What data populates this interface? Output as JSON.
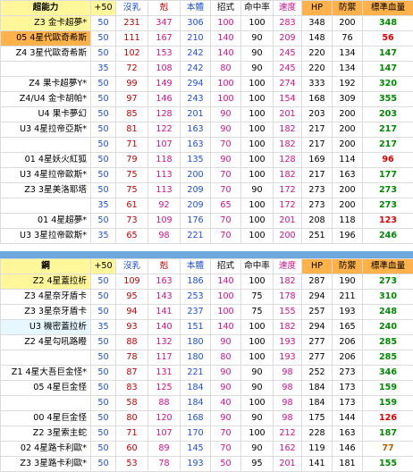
{
  "colors": {
    "header_yellow": "#fff79a",
    "header_orange": "#ffb14a",
    "blue_text": "#1f4fd6",
    "dark_red_text": "#c00000",
    "pink_text": "#d0118a",
    "green_text": "#008a00",
    "red_text": "#e00000",
    "separator": "#6fa8dc"
  },
  "top": {
    "header": [
      "超能力",
      "+50",
      "沒乳",
      "剋",
      "本體",
      "招式",
      "命中率",
      "速度",
      "HP",
      "防禦",
      "標準血量"
    ],
    "rows": [
      {
        "name": "Z3 金卡超夢*",
        "p50": "50",
        "a": "231",
        "b": "347",
        "c": "306",
        "d": "100",
        "e": "100",
        "f": "283",
        "hp": "348",
        "def": "200",
        "std": "348",
        "nameHl": "yellow",
        "stdColor": "green"
      },
      {
        "name": "05 4星代歐奇希斯",
        "p50": "50",
        "a": "111",
        "b": "167",
        "c": "210",
        "d": "140",
        "e": "90",
        "f": "209",
        "hp": "148",
        "def": "76",
        "std": "56",
        "nameHl": "orange",
        "stdColor": "red"
      },
      {
        "name": "Z4 3星代歐奇希斯",
        "p50": "50",
        "a": "102",
        "b": "153",
        "c": "242",
        "d": "140",
        "e": "90",
        "f": "245",
        "hp": "220",
        "def": "134",
        "std": "147",
        "nameHl": "",
        "stdColor": "green"
      },
      {
        "name": "",
        "p50": "35",
        "a": "72",
        "b": "108",
        "c": "242",
        "d": "80",
        "e": "90",
        "f": "245",
        "hp": "220",
        "def": "134",
        "std": "147",
        "nameHl": "",
        "stdColor": "green"
      },
      {
        "name": "Z4 果卡超夢Y*",
        "p50": "50",
        "a": "99",
        "b": "149",
        "c": "294",
        "d": "100",
        "e": "100",
        "f": "274",
        "hp": "333",
        "def": "192",
        "std": "320",
        "nameHl": "",
        "stdColor": "green"
      },
      {
        "name": "Z4/U4 金卡胡帕*",
        "p50": "50",
        "a": "97",
        "b": "146",
        "c": "243",
        "d": "100",
        "e": "100",
        "f": "154",
        "hp": "168",
        "def": "309",
        "std": "355",
        "nameHl": "",
        "stdColor": "green"
      },
      {
        "name": "U4 果卡夢幻",
        "p50": "50",
        "a": "85",
        "b": "128",
        "c": "201",
        "d": "90",
        "e": "100",
        "f": "201",
        "hp": "203",
        "def": "200",
        "std": "203",
        "nameHl": "",
        "stdColor": "green"
      },
      {
        "name": "U3 4星拉帝亞斯*",
        "p50": "50",
        "a": "81",
        "b": "122",
        "c": "163",
        "d": "90",
        "e": "100",
        "f": "182",
        "hp": "217",
        "def": "200",
        "std": "217",
        "nameHl": "",
        "stdColor": "green"
      },
      {
        "name": "",
        "p50": "50",
        "a": "71",
        "b": "107",
        "c": "163",
        "d": "70",
        "e": "100",
        "f": "182",
        "hp": "217",
        "def": "200",
        "std": "217",
        "nameHl": "",
        "stdColor": "green"
      },
      {
        "name": "01 4星妖火紅狐",
        "p50": "50",
        "a": "79",
        "b": "118",
        "c": "135",
        "d": "90",
        "e": "100",
        "f": "128",
        "hp": "169",
        "def": "114",
        "std": "96",
        "nameHl": "",
        "stdColor": "red"
      },
      {
        "name": "U3 4星拉帝歐斯*",
        "p50": "50",
        "a": "75",
        "b": "113",
        "c": "200",
        "d": "70",
        "e": "100",
        "f": "182",
        "hp": "217",
        "def": "163",
        "std": "177",
        "nameHl": "",
        "stdColor": "green"
      },
      {
        "name": "Z3 3星美洛耶塔",
        "p50": "50",
        "a": "75",
        "b": "113",
        "c": "209",
        "d": "70",
        "e": "90",
        "f": "172",
        "hp": "273",
        "def": "200",
        "std": "273",
        "nameHl": "",
        "stdColor": "green"
      },
      {
        "name": "",
        "p50": "35",
        "a": "61",
        "b": "92",
        "c": "209",
        "d": "65",
        "e": "100",
        "f": "172",
        "hp": "273",
        "def": "200",
        "std": "273",
        "nameHl": "",
        "stdColor": "green"
      },
      {
        "name": "01 4星超夢*",
        "p50": "50",
        "a": "73",
        "b": "109",
        "c": "176",
        "d": "70",
        "e": "100",
        "f": "201",
        "hp": "208",
        "def": "118",
        "std": "123",
        "nameHl": "",
        "stdColor": "red"
      },
      {
        "name": "U3 3星拉帝歐斯*",
        "p50": "35",
        "a": "65",
        "b": "98",
        "c": "221",
        "d": "70",
        "e": "100",
        "f": "200",
        "hp": "251",
        "def": "196",
        "std": "246",
        "nameHl": "",
        "stdColor": "green"
      }
    ]
  },
  "bottom": {
    "header": [
      "鋼",
      "+50",
      "沒乳",
      "剋",
      "本體",
      "招式",
      "命中率",
      "速度",
      "HP",
      "防禦",
      "標準血量"
    ],
    "rows": [
      {
        "name": "Z2 4星蓋拉析",
        "p50": "50",
        "a": "109",
        "b": "163",
        "c": "186",
        "d": "140",
        "e": "100",
        "f": "182",
        "hp": "287",
        "def": "190",
        "std": "273",
        "nameHl": "yellow",
        "stdColor": "green"
      },
      {
        "name": "Z3 4星奈牙盾卡",
        "p50": "50",
        "a": "95",
        "b": "143",
        "c": "253",
        "d": "100",
        "e": "75",
        "f": "178",
        "hp": "294",
        "def": "211",
        "std": "310",
        "nameHl": "",
        "stdColor": "green"
      },
      {
        "name": "Z3 3星奈牙盾卡",
        "p50": "50",
        "a": "94",
        "b": "141",
        "c": "237",
        "d": "100",
        "e": "75",
        "f": "155",
        "hp": "257",
        "def": "193",
        "std": "248",
        "nameHl": "",
        "stdColor": "green"
      },
      {
        "name": "U3 機密蓋拉析",
        "p50": "35",
        "a": "93",
        "b": "140",
        "c": "151",
        "d": "140",
        "e": "100",
        "f": "182",
        "hp": "294",
        "def": "165",
        "std": "240",
        "nameHl": "cyan",
        "stdColor": "green"
      },
      {
        "name": "Z2 4星勾吼路瞪",
        "p50": "50",
        "a": "88",
        "b": "132",
        "c": "180",
        "d": "90",
        "e": "100",
        "f": "193",
        "hp": "277",
        "def": "206",
        "std": "285",
        "nameHl": "",
        "stdColor": "green"
      },
      {
        "name": "",
        "p50": "50",
        "a": "78",
        "b": "117",
        "c": "180",
        "d": "80",
        "e": "100",
        "f": "193",
        "hp": "277",
        "def": "206",
        "std": "285",
        "nameHl": "",
        "stdColor": "green"
      },
      {
        "name": "Z1 4星大吾巨金怪*",
        "p50": "50",
        "a": "87",
        "b": "131",
        "c": "221",
        "d": "90",
        "e": "90",
        "f": "98",
        "hp": "252",
        "def": "273",
        "std": "346",
        "nameHl": "",
        "stdColor": "green"
      },
      {
        "name": "05 4星巨金怪",
        "p50": "50",
        "a": "83",
        "b": "125",
        "c": "184",
        "d": "90",
        "e": "90",
        "f": "98",
        "hp": "184",
        "def": "173",
        "std": "159",
        "nameHl": "",
        "stdColor": "green"
      },
      {
        "name": "",
        "p50": "50",
        "a": "58",
        "b": "88",
        "c": "184",
        "d": "40",
        "e": "100",
        "f": "98",
        "hp": "184",
        "def": "173",
        "std": "159",
        "nameHl": "",
        "stdColor": "green"
      },
      {
        "name": "00 4星巨金怪",
        "p50": "50",
        "a": "80",
        "b": "120",
        "c": "168",
        "d": "90",
        "e": "90",
        "f": "98",
        "hp": "175",
        "def": "144",
        "std": "126",
        "nameHl": "",
        "stdColor": "red"
      },
      {
        "name": "Z2 3星索主蛇",
        "p50": "50",
        "a": "71",
        "b": "107",
        "c": "170",
        "d": "70",
        "e": "100",
        "f": "212",
        "hp": "228",
        "def": "163",
        "std": "187",
        "nameHl": "",
        "stdColor": "green"
      },
      {
        "name": "02 4星路卡利歐*",
        "p50": "50",
        "a": "60",
        "b": "89",
        "c": "145",
        "d": "70",
        "e": "90",
        "f": "162",
        "hp": "119",
        "def": "146",
        "std": "77",
        "nameHl": "",
        "stdColor": "darkred"
      },
      {
        "name": "Z3 3星路卡利歐*",
        "p50": "50",
        "a": "53",
        "b": "78",
        "c": "193",
        "d": "50",
        "e": "95",
        "f": "201",
        "hp": "141",
        "def": "181",
        "std": "155",
        "nameHl": "",
        "stdColor": "green"
      }
    ]
  }
}
